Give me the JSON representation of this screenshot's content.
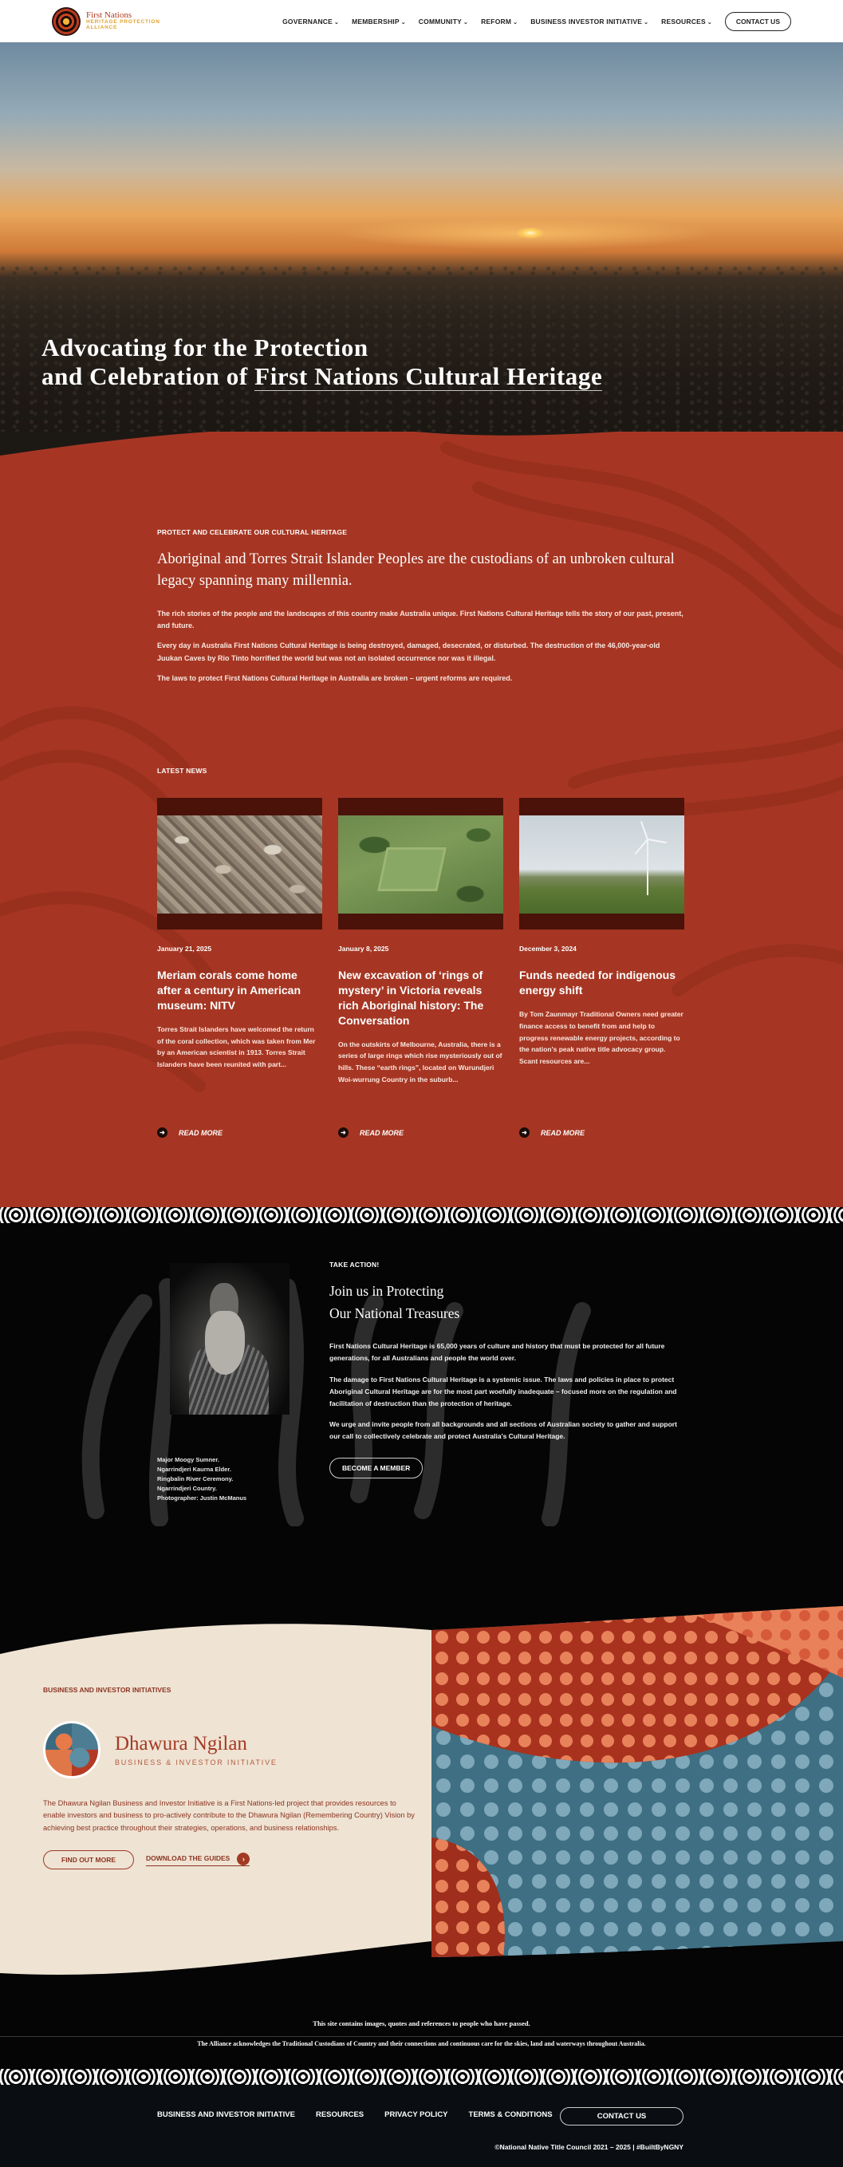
{
  "brand": {
    "line1": "First Nations",
    "line2": "HERITAGE PROTECTION",
    "line3": "ALLIANCE"
  },
  "nav": {
    "items": [
      {
        "label": "GOVERNANCE"
      },
      {
        "label": "MEMBERSHIP"
      },
      {
        "label": "COMMUNITY"
      },
      {
        "label": "REFORM"
      },
      {
        "label": "BUSINESS INVESTOR INITIATIVE"
      },
      {
        "label": "RESOURCES"
      }
    ],
    "contact": "CONTACT US"
  },
  "hero": {
    "line1": "Advocating for the Protection",
    "line2_plain": "and Celebration of ",
    "line2_underlined": "First Nations Cultural Heritage"
  },
  "intro": {
    "kicker": "PROTECT AND CELEBRATE OUR CULTURAL HERITAGE",
    "lead": "Aboriginal and Torres Strait Islander Peoples are the custodians of an unbroken cultural legacy spanning many millennia.",
    "p1": "The rich stories of the people and the landscapes of this country make Australia unique. First Nations Cultural Heritage tells the story of our past, present, and future.",
    "p2": "Every day in Australia First Nations Cultural Heritage is being destroyed, damaged, desecrated, or disturbed. The destruction of the 46,000-year-old Juukan Caves by Rio Tinto horrified the world but was not an isolated occurrence nor was it illegal.",
    "p3": "The laws to protect First Nations Cultural Heritage in Australia are broken – urgent reforms are required."
  },
  "news": {
    "heading": "LATEST NEWS",
    "read_more": "READ MORE",
    "items": [
      {
        "date": "January 21, 2025",
        "title": "Meriam corals come home after a century in American museum: NITV",
        "excerpt": "Torres Strait Islanders have welcomed the return of the coral collection, which was taken from Mer by an American scientist in 1913. Torres Strait Islanders have been reunited with part..."
      },
      {
        "date": "January 8, 2025",
        "title": "New excavation of ‘rings of mystery’ in Victoria reveals rich Aboriginal history: The Conversation",
        "excerpt": "On the outskirts of Melbourne, Australia, there is a series of large rings which rise mysteriously out of hills. These “earth rings”, located on Wurundjeri Woi-wurrung Country in the suburb..."
      },
      {
        "date": "December 3, 2024",
        "title": "Funds needed for indigenous energy shift",
        "excerpt": "By Tom Zaunmayr Traditional Owners need greater finance access to benefit from and help to progress renewable energy projects, according to the nation's peak native title advocacy group. Scant resources are..."
      }
    ]
  },
  "action": {
    "kicker": "TAKE ACTION!",
    "title1": "Join us in Protecting",
    "title2": "Our National Treasures",
    "p1": "First Nations Cultural Heritage is 65,000 years of culture and history that must be protected for all future generations, for all Australians and people the world over.",
    "p2": "The damage to First Nations Cultural Heritage is a systemic issue. The laws and policies in place to protect Aboriginal Cultural Heritage are for the most part woefully inadequate – focused more on the regulation and facilitation of destruction than the protection of heritage.",
    "p3": "We urge and invite people from all backgrounds and all sections of Australian society to gather and support our call to collectively celebrate and protect Australia's Cultural Heritage.",
    "button": "BECOME A MEMBER",
    "caption": [
      "Major Moogy Sumner.",
      "Ngarrindjeri Kaurna Elder.",
      "Ringbalin River Ceremony.",
      "Ngarrindjeri Country.",
      "Photographer: Justin McManus"
    ]
  },
  "dhawura": {
    "kicker": "BUSINESS AND INVESTOR INITIATIVES",
    "name": "Dhawura Ngilan",
    "sub": "BUSINESS & INVESTOR INITIATIVE",
    "p": "The Dhawura Ngilan Business and Investor Initiative is a First Nations-led project that provides resources to enable investors and business to pro-actively contribute to the Dhawura Ngilan (Remembering Country) Vision by achieving best practice throughout their strategies, operations, and business relationships.",
    "find_out": "FIND OUT MORE",
    "download": "DOWNLOAD THE GUIDES"
  },
  "notice": {
    "warning": "This site contains images, quotes and references to people who have passed.",
    "acknowledgement": "The Alliance acknowledges the Traditional Custodians of Country and their connections and continuous care for the skies, land and waterways throughout Australia."
  },
  "footer": {
    "links": [
      "BUSINESS AND INVESTOR INITIATIVE",
      "RESOURCES",
      "PRIVACY POLICY",
      "TERMS & CONDITIONS"
    ],
    "contact": "CONTACT US",
    "copyright": "©National Native Title Council 2021 – 2025 | #BuiltByNGNY"
  },
  "colors": {
    "red": "#a63623",
    "cream": "#efe3d3",
    "dark": "#050505",
    "accent_text": "#8c3422"
  }
}
